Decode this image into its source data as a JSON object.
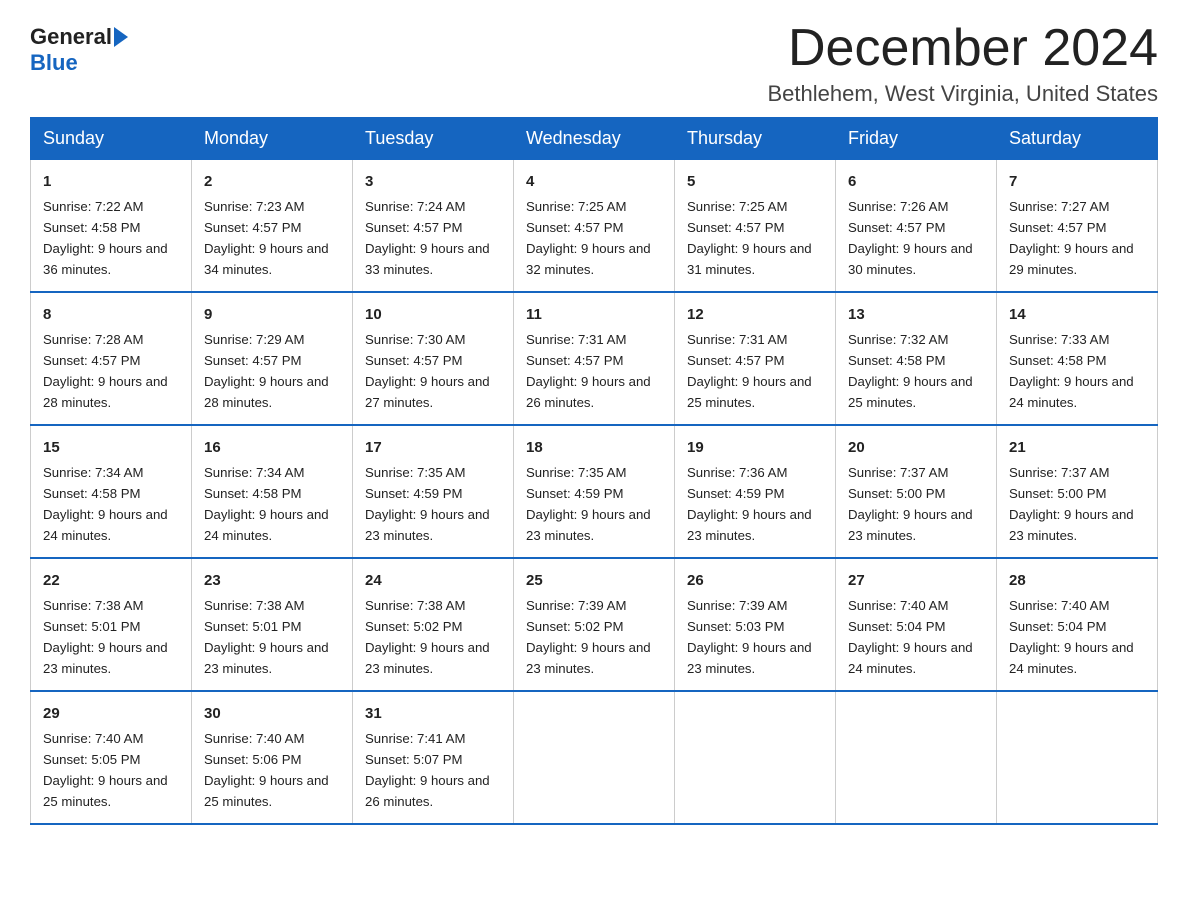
{
  "header": {
    "logo_general": "General",
    "logo_blue": "Blue",
    "month_title": "December 2024",
    "location": "Bethlehem, West Virginia, United States"
  },
  "weekdays": [
    "Sunday",
    "Monday",
    "Tuesday",
    "Wednesday",
    "Thursday",
    "Friday",
    "Saturday"
  ],
  "weeks": [
    [
      {
        "day": "1",
        "sunrise": "7:22 AM",
        "sunset": "4:58 PM",
        "daylight": "9 hours and 36 minutes."
      },
      {
        "day": "2",
        "sunrise": "7:23 AM",
        "sunset": "4:57 PM",
        "daylight": "9 hours and 34 minutes."
      },
      {
        "day": "3",
        "sunrise": "7:24 AM",
        "sunset": "4:57 PM",
        "daylight": "9 hours and 33 minutes."
      },
      {
        "day": "4",
        "sunrise": "7:25 AM",
        "sunset": "4:57 PM",
        "daylight": "9 hours and 32 minutes."
      },
      {
        "day": "5",
        "sunrise": "7:25 AM",
        "sunset": "4:57 PM",
        "daylight": "9 hours and 31 minutes."
      },
      {
        "day": "6",
        "sunrise": "7:26 AM",
        "sunset": "4:57 PM",
        "daylight": "9 hours and 30 minutes."
      },
      {
        "day": "7",
        "sunrise": "7:27 AM",
        "sunset": "4:57 PM",
        "daylight": "9 hours and 29 minutes."
      }
    ],
    [
      {
        "day": "8",
        "sunrise": "7:28 AM",
        "sunset": "4:57 PM",
        "daylight": "9 hours and 28 minutes."
      },
      {
        "day": "9",
        "sunrise": "7:29 AM",
        "sunset": "4:57 PM",
        "daylight": "9 hours and 28 minutes."
      },
      {
        "day": "10",
        "sunrise": "7:30 AM",
        "sunset": "4:57 PM",
        "daylight": "9 hours and 27 minutes."
      },
      {
        "day": "11",
        "sunrise": "7:31 AM",
        "sunset": "4:57 PM",
        "daylight": "9 hours and 26 minutes."
      },
      {
        "day": "12",
        "sunrise": "7:31 AM",
        "sunset": "4:57 PM",
        "daylight": "9 hours and 25 minutes."
      },
      {
        "day": "13",
        "sunrise": "7:32 AM",
        "sunset": "4:58 PM",
        "daylight": "9 hours and 25 minutes."
      },
      {
        "day": "14",
        "sunrise": "7:33 AM",
        "sunset": "4:58 PM",
        "daylight": "9 hours and 24 minutes."
      }
    ],
    [
      {
        "day": "15",
        "sunrise": "7:34 AM",
        "sunset": "4:58 PM",
        "daylight": "9 hours and 24 minutes."
      },
      {
        "day": "16",
        "sunrise": "7:34 AM",
        "sunset": "4:58 PM",
        "daylight": "9 hours and 24 minutes."
      },
      {
        "day": "17",
        "sunrise": "7:35 AM",
        "sunset": "4:59 PM",
        "daylight": "9 hours and 23 minutes."
      },
      {
        "day": "18",
        "sunrise": "7:35 AM",
        "sunset": "4:59 PM",
        "daylight": "9 hours and 23 minutes."
      },
      {
        "day": "19",
        "sunrise": "7:36 AM",
        "sunset": "4:59 PM",
        "daylight": "9 hours and 23 minutes."
      },
      {
        "day": "20",
        "sunrise": "7:37 AM",
        "sunset": "5:00 PM",
        "daylight": "9 hours and 23 minutes."
      },
      {
        "day": "21",
        "sunrise": "7:37 AM",
        "sunset": "5:00 PM",
        "daylight": "9 hours and 23 minutes."
      }
    ],
    [
      {
        "day": "22",
        "sunrise": "7:38 AM",
        "sunset": "5:01 PM",
        "daylight": "9 hours and 23 minutes."
      },
      {
        "day": "23",
        "sunrise": "7:38 AM",
        "sunset": "5:01 PM",
        "daylight": "9 hours and 23 minutes."
      },
      {
        "day": "24",
        "sunrise": "7:38 AM",
        "sunset": "5:02 PM",
        "daylight": "9 hours and 23 minutes."
      },
      {
        "day": "25",
        "sunrise": "7:39 AM",
        "sunset": "5:02 PM",
        "daylight": "9 hours and 23 minutes."
      },
      {
        "day": "26",
        "sunrise": "7:39 AM",
        "sunset": "5:03 PM",
        "daylight": "9 hours and 23 minutes."
      },
      {
        "day": "27",
        "sunrise": "7:40 AM",
        "sunset": "5:04 PM",
        "daylight": "9 hours and 24 minutes."
      },
      {
        "day": "28",
        "sunrise": "7:40 AM",
        "sunset": "5:04 PM",
        "daylight": "9 hours and 24 minutes."
      }
    ],
    [
      {
        "day": "29",
        "sunrise": "7:40 AM",
        "sunset": "5:05 PM",
        "daylight": "9 hours and 25 minutes."
      },
      {
        "day": "30",
        "sunrise": "7:40 AM",
        "sunset": "5:06 PM",
        "daylight": "9 hours and 25 minutes."
      },
      {
        "day": "31",
        "sunrise": "7:41 AM",
        "sunset": "5:07 PM",
        "daylight": "9 hours and 26 minutes."
      },
      null,
      null,
      null,
      null
    ]
  ],
  "labels": {
    "sunrise": "Sunrise:",
    "sunset": "Sunset:",
    "daylight": "Daylight:"
  }
}
